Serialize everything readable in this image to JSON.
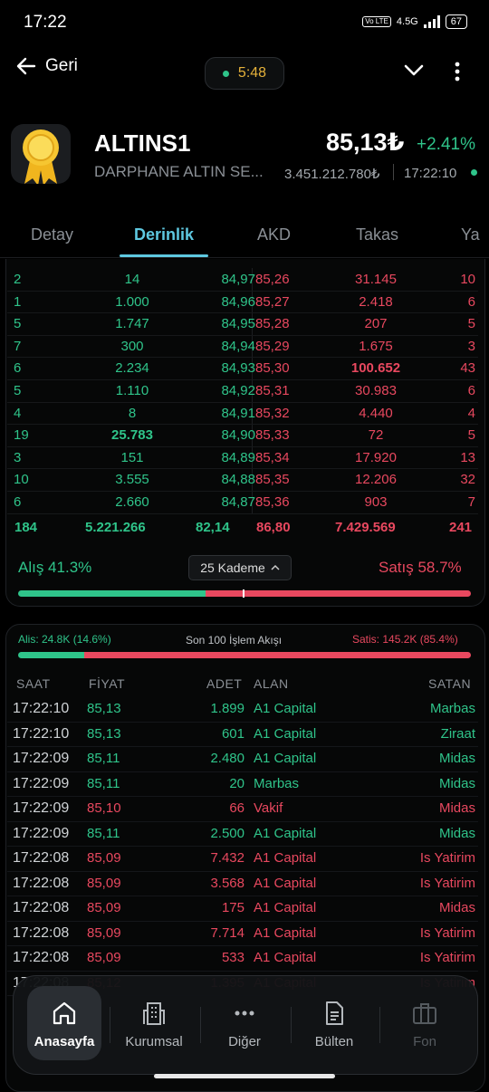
{
  "status_bar": {
    "time": "17:22",
    "network": "4.5G",
    "volte": "Vo LTE",
    "battery": "67"
  },
  "topbar": {
    "back_label": "Geri",
    "timer": "5:48"
  },
  "header": {
    "symbol": "ALTINS1",
    "name": "DARPHANE ALTIN SE...",
    "price": "85,13₺",
    "change": "+2.41%",
    "volume": "3.451.212.780₺",
    "time": "17:22:10"
  },
  "tabs": [
    "Detay",
    "Derinlik",
    "AKD",
    "Takas",
    "Ya"
  ],
  "depth": {
    "rows": [
      {
        "bid_orders": "2",
        "bid_qty": "14",
        "bid": "84,97",
        "ask": "85,26",
        "ask_qty": "31.145",
        "ask_orders": "10"
      },
      {
        "bid_orders": "1",
        "bid_qty": "1.000",
        "bid": "84,96",
        "ask": "85,27",
        "ask_qty": "2.418",
        "ask_orders": "6"
      },
      {
        "bid_orders": "5",
        "bid_qty": "1.747",
        "bid": "84,95",
        "ask": "85,28",
        "ask_qty": "207",
        "ask_orders": "5"
      },
      {
        "bid_orders": "7",
        "bid_qty": "300",
        "bid": "84,94",
        "ask": "85,29",
        "ask_qty": "1.675",
        "ask_orders": "3"
      },
      {
        "bid_orders": "6",
        "bid_qty": "2.234",
        "bid": "84,93",
        "ask": "85,30",
        "ask_qty": "100.652",
        "ask_orders": "43"
      },
      {
        "bid_orders": "5",
        "bid_qty": "1.110",
        "bid": "84,92",
        "ask": "85,31",
        "ask_qty": "30.983",
        "ask_orders": "6"
      },
      {
        "bid_orders": "4",
        "bid_qty": "8",
        "bid": "84,91",
        "ask": "85,32",
        "ask_qty": "4.440",
        "ask_orders": "4"
      },
      {
        "bid_orders": "19",
        "bid_qty": "25.783",
        "bid": "84,90",
        "ask": "85,33",
        "ask_qty": "72",
        "ask_orders": "5"
      },
      {
        "bid_orders": "3",
        "bid_qty": "151",
        "bid": "84,89",
        "ask": "85,34",
        "ask_qty": "17.920",
        "ask_orders": "13"
      },
      {
        "bid_orders": "10",
        "bid_qty": "3.555",
        "bid": "84,88",
        "ask": "85,35",
        "ask_qty": "12.206",
        "ask_orders": "32"
      },
      {
        "bid_orders": "6",
        "bid_qty": "2.660",
        "bid": "84,87",
        "ask": "85,36",
        "ask_qty": "903",
        "ask_orders": "7"
      }
    ],
    "totals": {
      "bid_orders": "184",
      "bid_qty": "5.221.266",
      "bid_avg": "82,14",
      "ask_avg": "86,80",
      "ask_qty": "7.429.569",
      "ask_orders": "241"
    },
    "buy_ratio": "Alış 41.3%",
    "sell_ratio": "Satış 58.7%",
    "buy_fraction": 0.413,
    "levels_label": "25 Kademe"
  },
  "trades": {
    "buy_summary": "Alis: 24.8K (14.6%)",
    "title": "Son 100 İşlem Akışı",
    "sell_summary": "Satis: 145.2K (85.4%)",
    "buy_fraction": 0.146,
    "columns": [
      "SAAT",
      "FİYAT",
      "ADET",
      "ALAN",
      "SATAN"
    ],
    "rows": [
      {
        "time": "17:22:10",
        "price": "85,13",
        "qty": "1.899",
        "buyer": "A1 Capital",
        "seller": "Marbas",
        "side": "buy"
      },
      {
        "time": "17:22:10",
        "price": "85,13",
        "qty": "601",
        "buyer": "A1 Capital",
        "seller": "Ziraat",
        "side": "buy"
      },
      {
        "time": "17:22:09",
        "price": "85,11",
        "qty": "2.480",
        "buyer": "A1 Capital",
        "seller": "Midas",
        "side": "buy"
      },
      {
        "time": "17:22:09",
        "price": "85,11",
        "qty": "20",
        "buyer": "Marbas",
        "seller": "Midas",
        "side": "buy"
      },
      {
        "time": "17:22:09",
        "price": "85,10",
        "qty": "66",
        "buyer": "Vakif",
        "seller": "Midas",
        "side": "sell"
      },
      {
        "time": "17:22:09",
        "price": "85,11",
        "qty": "2.500",
        "buyer": "A1 Capital",
        "seller": "Midas",
        "side": "buy"
      },
      {
        "time": "17:22:08",
        "price": "85,09",
        "qty": "7.432",
        "buyer": "A1 Capital",
        "seller": "Is Yatirim",
        "side": "sell"
      },
      {
        "time": "17:22:08",
        "price": "85,09",
        "qty": "3.568",
        "buyer": "A1 Capital",
        "seller": "Is Yatirim",
        "side": "sell"
      },
      {
        "time": "17:22:08",
        "price": "85,09",
        "qty": "175",
        "buyer": "A1 Capital",
        "seller": "Midas",
        "side": "sell"
      },
      {
        "time": "17:22:08",
        "price": "85,09",
        "qty": "7.714",
        "buyer": "A1 Capital",
        "seller": "Is Yatirim",
        "side": "sell"
      },
      {
        "time": "17:22:08",
        "price": "85,09",
        "qty": "533",
        "buyer": "A1 Capital",
        "seller": "Is Yatirim",
        "side": "sell"
      },
      {
        "time": "17:22:08",
        "price": "85,12",
        "qty": "1.395",
        "buyer": "A1 Capital",
        "seller": "Is Yatirim",
        "side": "sell"
      }
    ]
  },
  "nav": [
    {
      "label": "Anasayfa",
      "icon": "home-icon"
    },
    {
      "label": "Kurumsal",
      "icon": "building-icon"
    },
    {
      "label": "Diğer",
      "icon": "more-dots-icon"
    },
    {
      "label": "Bülten",
      "icon": "document-icon"
    },
    {
      "label": "Fon",
      "icon": "briefcase-icon"
    }
  ],
  "colors": {
    "buy": "#2fc48a",
    "sell": "#e8485f",
    "accent": "#5ec8e0",
    "timer": "#e5b13a"
  }
}
